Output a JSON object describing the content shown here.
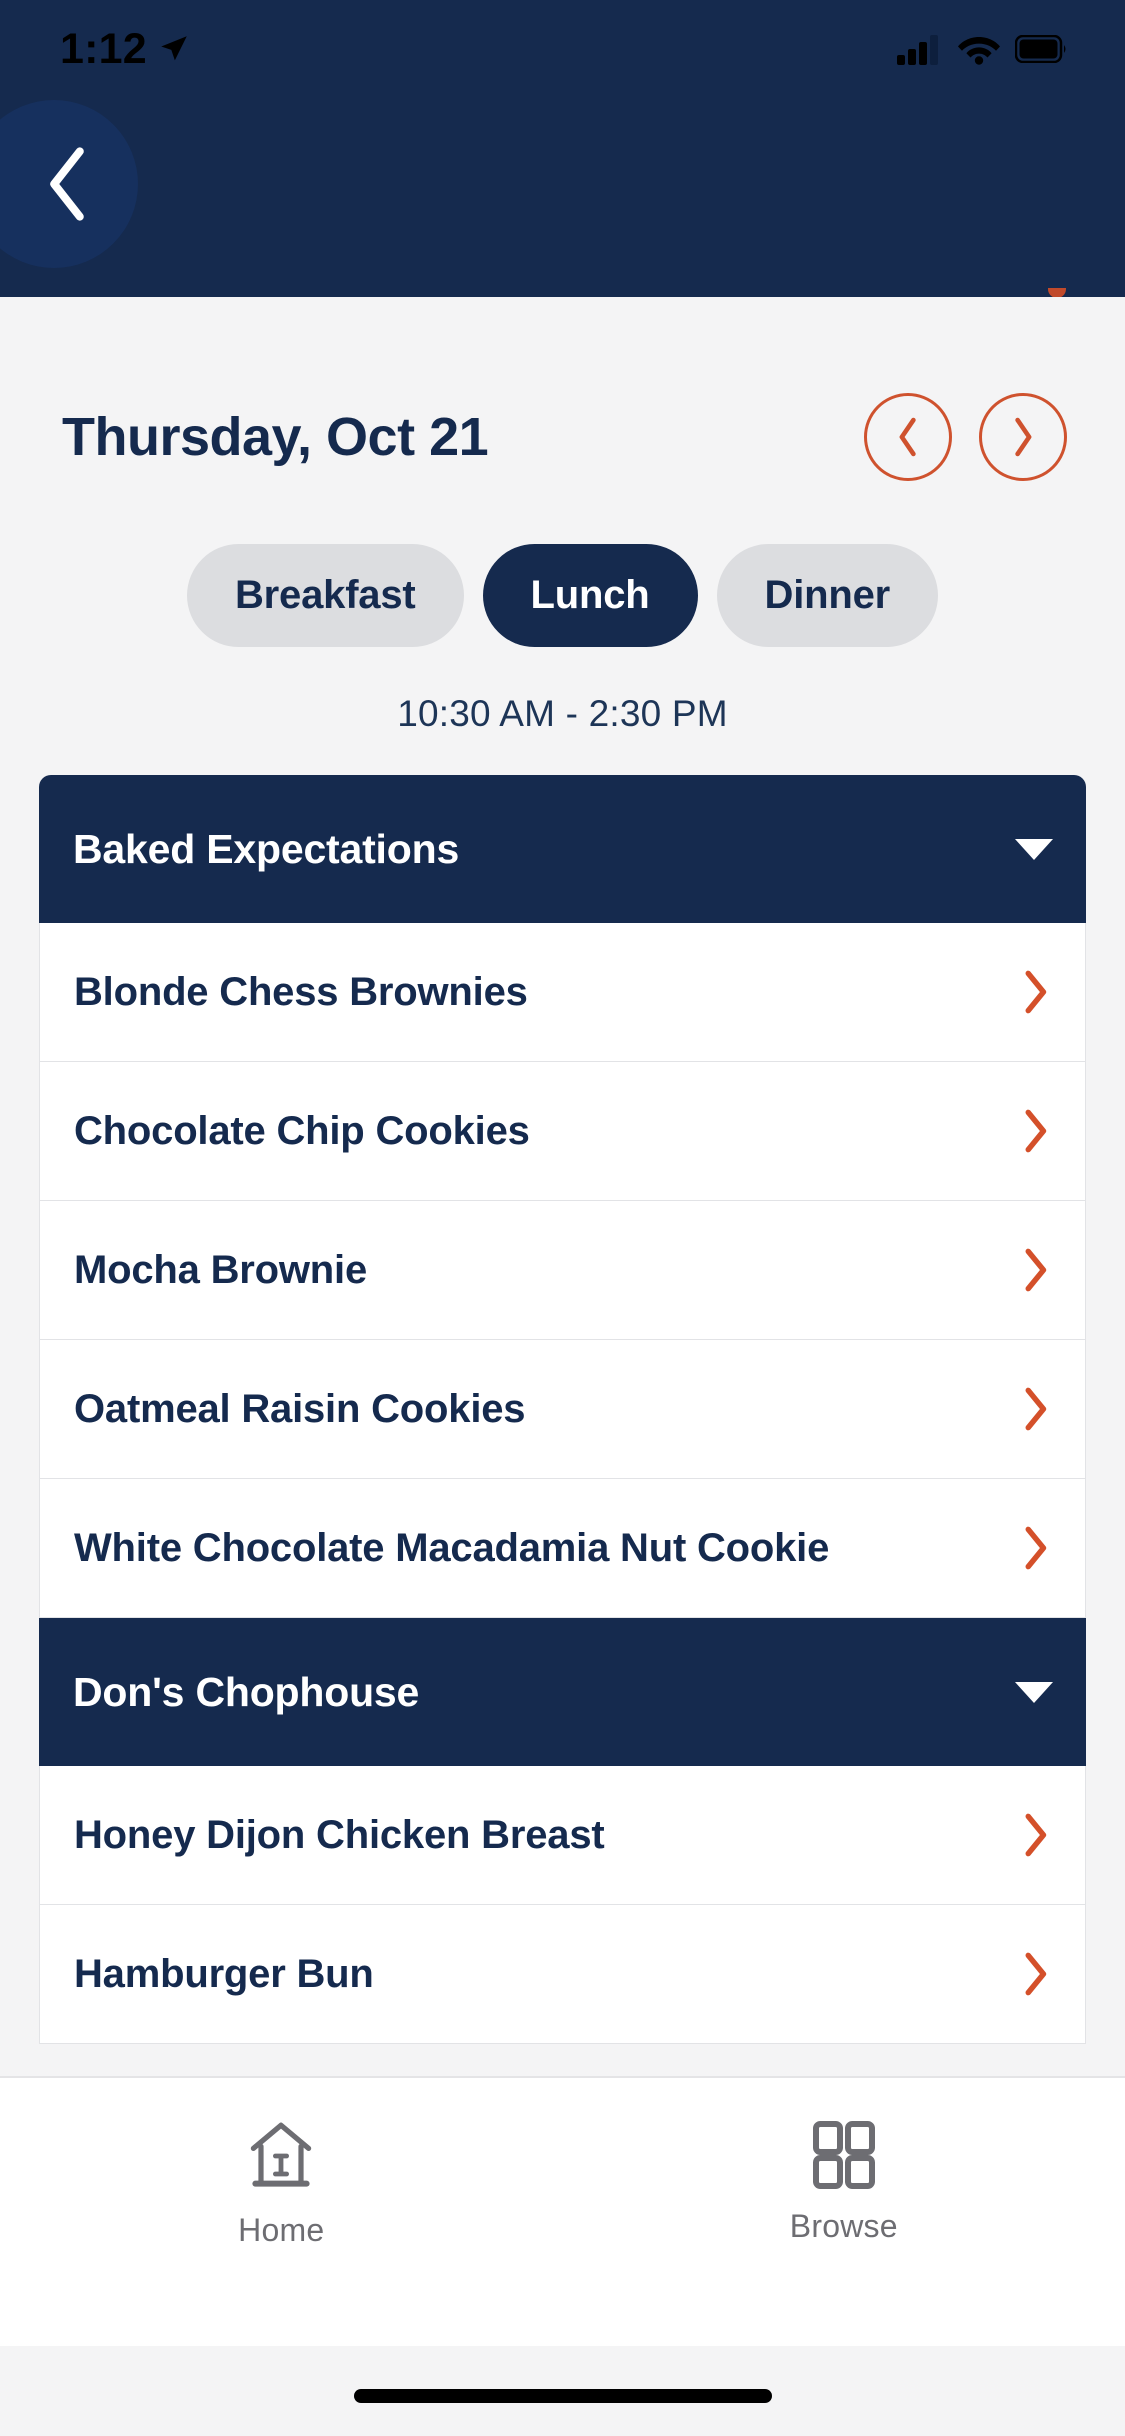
{
  "status_bar": {
    "time": "1:12",
    "location_icon": "location-arrow-icon",
    "signal_icon": "cellular-signal-icon",
    "wifi_icon": "wifi-icon",
    "battery_icon": "battery-full-icon"
  },
  "header": {
    "back_icon": "chevron-left-icon",
    "background_color": "#152a4e"
  },
  "date_nav": {
    "date_label": "Thursday, Oct 21",
    "prev_icon": "chevron-left-icon",
    "next_icon": "chevron-right-icon",
    "accent_color": "#cf522e"
  },
  "meal_tabs": [
    {
      "label": "Breakfast",
      "selected": false
    },
    {
      "label": "Lunch",
      "selected": true
    },
    {
      "label": "Dinner",
      "selected": false
    }
  ],
  "meal_hours": "10:30 AM - 2:30 PM",
  "stations": [
    {
      "name": "Baked Expectations",
      "caret_icon": "caret-down-icon",
      "items": [
        {
          "name": "Blonde Chess Brownies",
          "chevron_icon": "chevron-right-icon"
        },
        {
          "name": "Chocolate Chip Cookies",
          "chevron_icon": "chevron-right-icon"
        },
        {
          "name": "Mocha Brownie",
          "chevron_icon": "chevron-right-icon"
        },
        {
          "name": "Oatmeal Raisin Cookies",
          "chevron_icon": "chevron-right-icon"
        },
        {
          "name": "White Chocolate Macadamia Nut Cookie",
          "chevron_icon": "chevron-right-icon"
        }
      ]
    },
    {
      "name": "Don's Chophouse",
      "caret_icon": "caret-down-icon",
      "items": [
        {
          "name": "Honey Dijon Chicken Breast",
          "chevron_icon": "chevron-right-icon"
        },
        {
          "name": "Hamburger Bun",
          "chevron_icon": "chevron-right-icon"
        }
      ]
    }
  ],
  "tab_bar": [
    {
      "label": "Home",
      "icon": "home-icon"
    },
    {
      "label": "Browse",
      "icon": "grid-icon"
    }
  ],
  "colors": {
    "navy": "#152a4e",
    "orange": "#cf522e",
    "page_background": "#f4f4f5",
    "inactive_tab": "#dcdde0",
    "tab_bar_text": "#6d6d72"
  }
}
